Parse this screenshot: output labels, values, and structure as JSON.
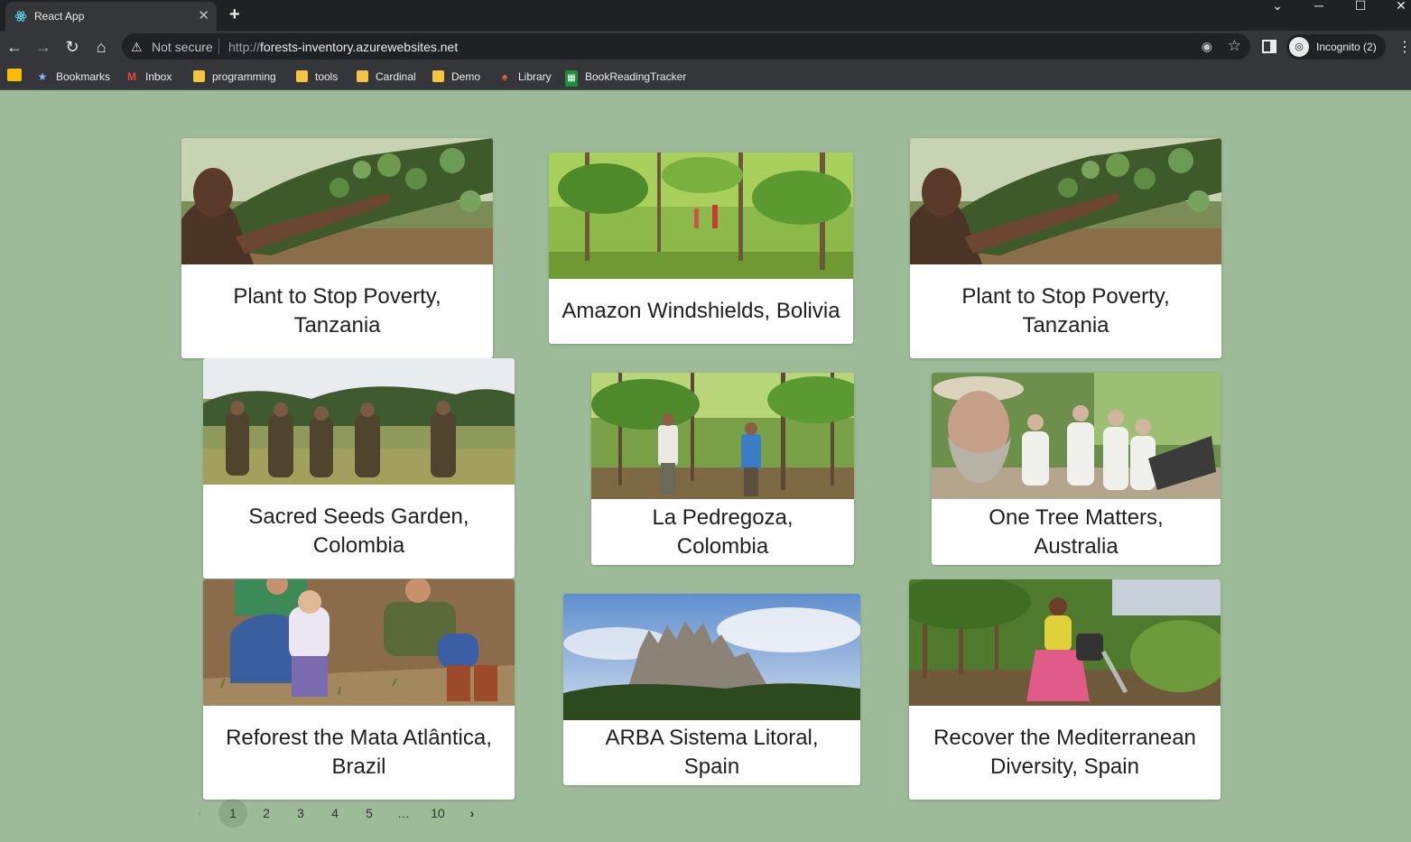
{
  "browser": {
    "tab_title": "React App",
    "new_tab": "+",
    "security_label": "Not secure",
    "url_scheme": "http://",
    "url_host": "forests-inventory.azurewebsites.net",
    "profile_label": "Incognito (2)"
  },
  "bookmarks": [
    {
      "label": "Bookmarks",
      "icon": "star-icon"
    },
    {
      "label": "Inbox",
      "icon": "gmail-icon"
    },
    {
      "label": "programming",
      "icon": "folder-icon"
    },
    {
      "label": "tools",
      "icon": "folder-icon"
    },
    {
      "label": "Cardinal",
      "icon": "folder-icon"
    },
    {
      "label": "Demo",
      "icon": "folder-icon"
    },
    {
      "label": "Library",
      "icon": "library-icon"
    },
    {
      "label": "BookReadingTracker",
      "icon": "sheets-icon"
    }
  ],
  "projects": [
    {
      "title": "Plant to Stop Poverty, Tanzania"
    },
    {
      "title": "Amazon Windshields, Bolivia"
    },
    {
      "title": "Plant to Stop Poverty, Tanzania"
    },
    {
      "title": "Sacred Seeds Garden, Colombia"
    },
    {
      "title": "La Pedregoza, Colombia"
    },
    {
      "title": "One Tree Matters, Australia"
    },
    {
      "title": "Reforest the Mata Atlântica, Brazil"
    },
    {
      "title": "ARBA Sistema Litoral, Spain"
    },
    {
      "title": "Recover the Mediterranean Diversity, Spain"
    }
  ],
  "pagination": {
    "prev": "‹",
    "pages": [
      "1",
      "2",
      "3",
      "4",
      "5"
    ],
    "ellipsis": "…",
    "last": "10",
    "next": "›",
    "current": 1
  },
  "colors": {
    "page_background": "#9dbb98",
    "card_background": "#ffffff",
    "chrome_dark": "#202124",
    "chrome_toolbar": "#35363a"
  }
}
